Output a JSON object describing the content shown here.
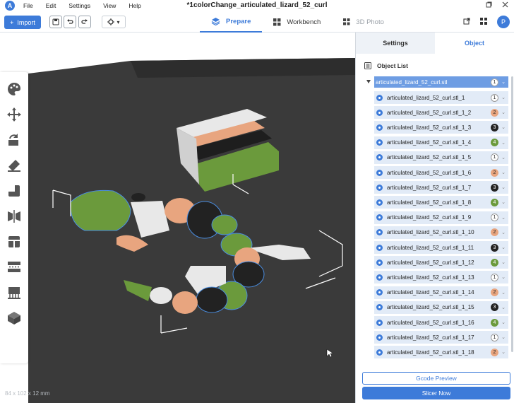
{
  "app": {
    "title": "*1colorChange_articulated_lizard_52_curl",
    "logo_letter": "A",
    "menu": [
      "File",
      "Edit",
      "Settings",
      "View",
      "Help"
    ]
  },
  "toolbar": {
    "import_label": "Import",
    "tabs": [
      {
        "label": "Prepare",
        "icon": "layers-icon",
        "state": "active"
      },
      {
        "label": "Workbench",
        "icon": "grid-icon",
        "state": "normal"
      },
      {
        "label": "3D Photo",
        "icon": "grid-icon",
        "state": "disabled"
      }
    ],
    "avatar_letter": "P"
  },
  "viewport": {
    "dimensions": "84 x 102 x 12 mm",
    "left_tools": [
      "palette-icon",
      "move-icon",
      "rotate-icon",
      "scale-icon",
      "place-on-face-icon",
      "mirror-icon",
      "cut-icon",
      "support-icon",
      "seam-icon",
      "assembly-icon"
    ]
  },
  "panel": {
    "tabs": [
      {
        "label": "Settings",
        "active": false
      },
      {
        "label": "Object",
        "active": true
      }
    ],
    "object_list_title": "Object List",
    "parent": {
      "name": "articulated_lizard_52_curl.stl",
      "filament": "1"
    },
    "objects": [
      {
        "name": "articulated_lizard_52_curl.stl_1",
        "filament": "1"
      },
      {
        "name": "articulated_lizard_52_curl.stl_1_2",
        "filament": "2"
      },
      {
        "name": "articulated_lizard_52_curl.stl_1_3",
        "filament": "3"
      },
      {
        "name": "articulated_lizard_52_curl.stl_1_4",
        "filament": "4"
      },
      {
        "name": "articulated_lizard_52_curl.stl_1_5",
        "filament": "1"
      },
      {
        "name": "articulated_lizard_52_curl.stl_1_6",
        "filament": "2"
      },
      {
        "name": "articulated_lizard_52_curl.stl_1_7",
        "filament": "3"
      },
      {
        "name": "articulated_lizard_52_curl.stl_1_8",
        "filament": "4"
      },
      {
        "name": "articulated_lizard_52_curl.stl_1_9",
        "filament": "1"
      },
      {
        "name": "articulated_lizard_52_curl.stl_1_10",
        "filament": "2"
      },
      {
        "name": "articulated_lizard_52_curl.stl_1_11",
        "filament": "3"
      },
      {
        "name": "articulated_lizard_52_curl.stl_1_12",
        "filament": "4"
      },
      {
        "name": "articulated_lizard_52_curl.stl_1_13",
        "filament": "1"
      },
      {
        "name": "articulated_lizard_52_curl.stl_1_14",
        "filament": "2"
      },
      {
        "name": "articulated_lizard_52_curl.stl_1_15",
        "filament": "3"
      },
      {
        "name": "articulated_lizard_52_curl.stl_1_16",
        "filament": "4"
      },
      {
        "name": "articulated_lizard_52_curl.stl_1_17",
        "filament": "1"
      },
      {
        "name": "articulated_lizard_52_curl.stl_1_18",
        "filament": "2"
      }
    ],
    "filament_colors": {
      "1": "#ffffff",
      "2": "#e8a57f",
      "3": "#222222",
      "4": "#6b9a3c"
    },
    "gcode_preview_label": "Gcode Preview",
    "slice_label": "Slicer Now"
  }
}
